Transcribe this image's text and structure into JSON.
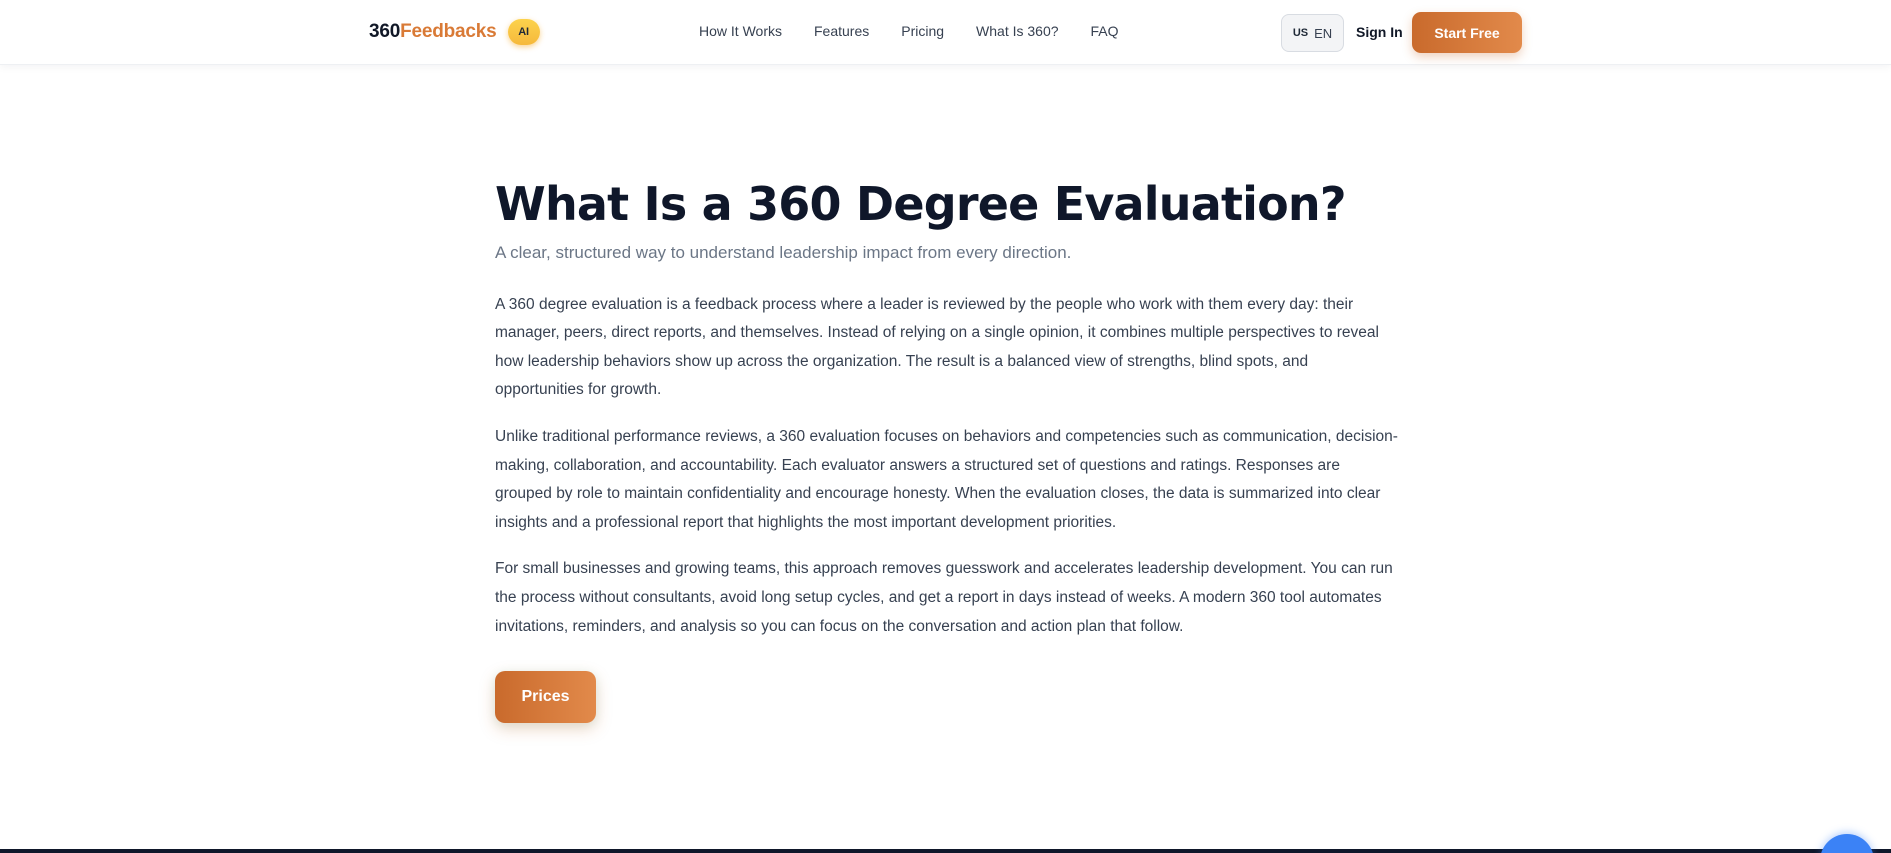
{
  "header": {
    "brand": {
      "number": "360",
      "word": "Feedbacks",
      "badge": "AI"
    },
    "nav": [
      "How It Works",
      "Features",
      "Pricing",
      "What Is 360?",
      "FAQ"
    ],
    "language": {
      "flag": "US",
      "code": "EN"
    },
    "sign_in": "Sign In",
    "start_free": "Start Free"
  },
  "main": {
    "title": "What Is a 360 Degree Evaluation?",
    "subtitle": "A clear, structured way to understand leadership impact from every direction.",
    "paragraphs": [
      "A 360 degree evaluation is a feedback process where a leader is reviewed by the people who work with them every day: their manager, peers, direct reports, and themselves. Instead of relying on a single opinion, it combines multiple perspectives to reveal how leadership behaviors show up across the organization. The result is a balanced view of strengths, blind spots, and opportunities for growth.",
      "Unlike traditional performance reviews, a 360 evaluation focuses on behaviors and competencies such as communication, decision-making, collaboration, and accountability. Each evaluator answers a structured set of questions and ratings. Responses are grouped by role to maintain confidentiality and encourage honesty. When the evaluation closes, the data is summarized into clear insights and a professional report that highlights the most important development priorities.",
      "For small businesses and growing teams, this approach removes guesswork and accelerates leadership development. You can run the process without consultants, avoid long setup cycles, and get a report in days instead of weeks. A modern 360 tool automates invitations, reminders, and analysis so you can focus on the conversation and action plan that follow."
    ],
    "cta": "Prices"
  },
  "colors": {
    "accent": "#d97a36",
    "accent_gradient_start": "#c96a2c",
    "accent_gradient_end": "#e28a4b",
    "badge": "#f6b93b",
    "heading": "#0f172a",
    "body_text": "#374151",
    "muted_text": "#6b7686",
    "footer": "#0f172a",
    "chat_widget": "#3b82f6"
  },
  "icons": {
    "chat_widget": "chat-bubble-icon"
  }
}
